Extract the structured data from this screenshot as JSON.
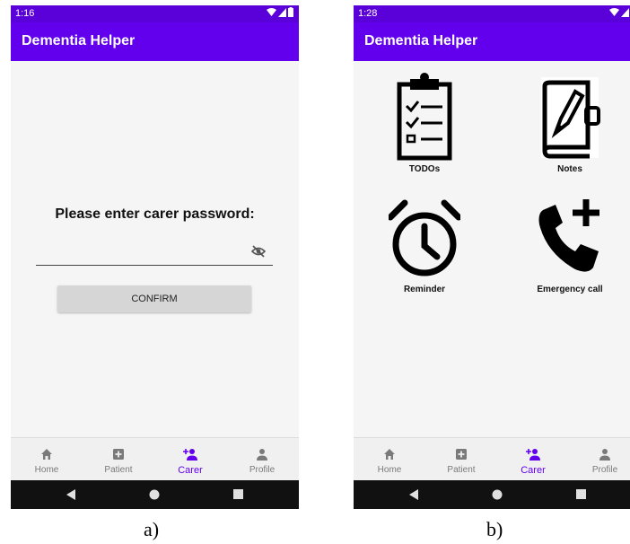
{
  "screen_a": {
    "status": {
      "time": "1:16"
    },
    "app_title": "Dementia Helper",
    "prompt": "Please enter carer password:",
    "password": {
      "value": "",
      "placeholder": ""
    },
    "confirm_label": "CONFIRM",
    "caption": "a)"
  },
  "screen_b": {
    "status": {
      "time": "1:28"
    },
    "app_title": "Dementia Helper",
    "tiles": [
      {
        "label": "TODOs",
        "icon": "clipboard-checklist-icon"
      },
      {
        "label": "Notes",
        "icon": "notebook-pen-icon"
      },
      {
        "label": "Reminder",
        "icon": "alarm-clock-icon"
      },
      {
        "label": "Emergency call",
        "icon": "phone-add-icon"
      }
    ],
    "caption": "b)"
  },
  "bottom_nav": {
    "items": [
      {
        "label": "Home",
        "icon": "home-icon"
      },
      {
        "label": "Patient",
        "icon": "plus-box-icon"
      },
      {
        "label": "Carer",
        "icon": "add-person-icon"
      },
      {
        "label": "Profile",
        "icon": "person-icon"
      }
    ],
    "active": "Carer"
  },
  "colors": {
    "primary": "#6200ee",
    "status_bar": "#5a00d8",
    "active_nav": "#6200ee"
  }
}
